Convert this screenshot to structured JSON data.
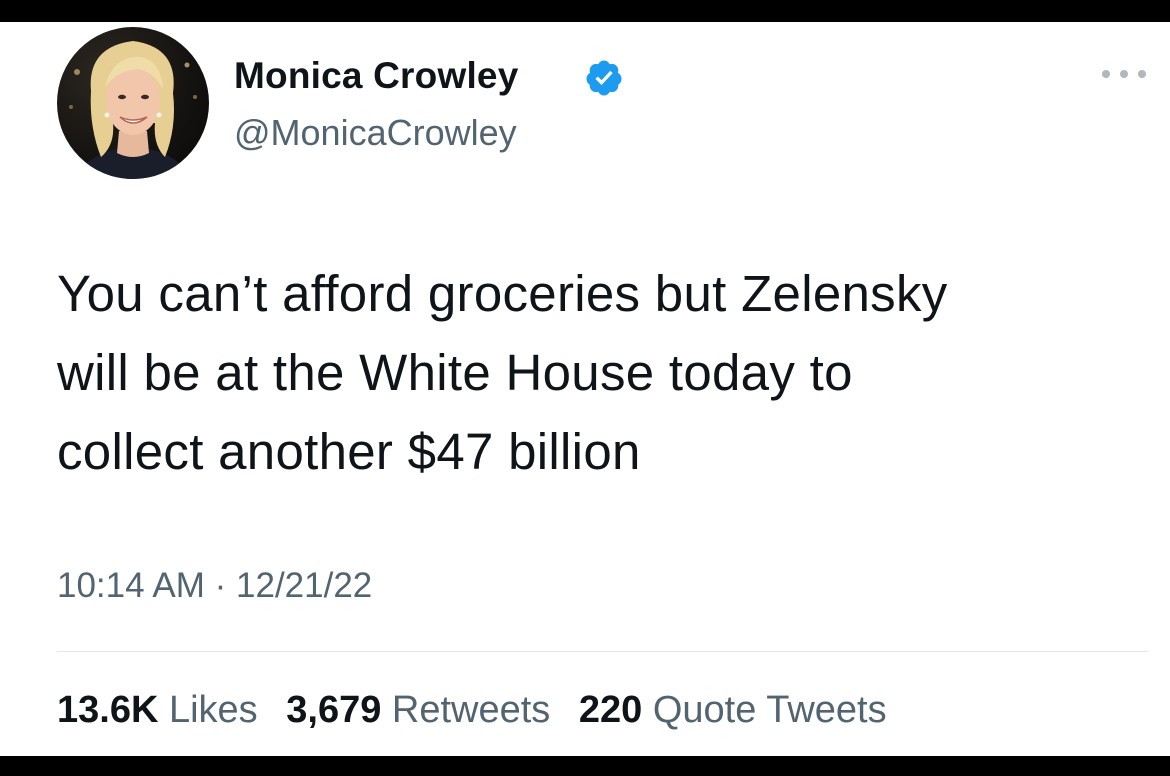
{
  "tweet": {
    "author": {
      "display_name": "Monica Crowley",
      "handle": "@MonicaCrowley",
      "verified_icon": "verified-badge-icon",
      "verified_color": "#1d9bf0"
    },
    "text_lines": [
      "You can’t afford groceries but Zelensky",
      "will be at the White House today to",
      "collect another $47 billion"
    ],
    "time": "10:14 AM",
    "separator": "·",
    "date": "12/21/22",
    "stats": {
      "likes_count": "13.6K",
      "likes_label": "Likes",
      "retweets_count": "3,679",
      "retweets_label": "Retweets",
      "quotes_count": "220",
      "quotes_label": "Quote Tweets"
    },
    "more_icon": "more-options-icon"
  }
}
